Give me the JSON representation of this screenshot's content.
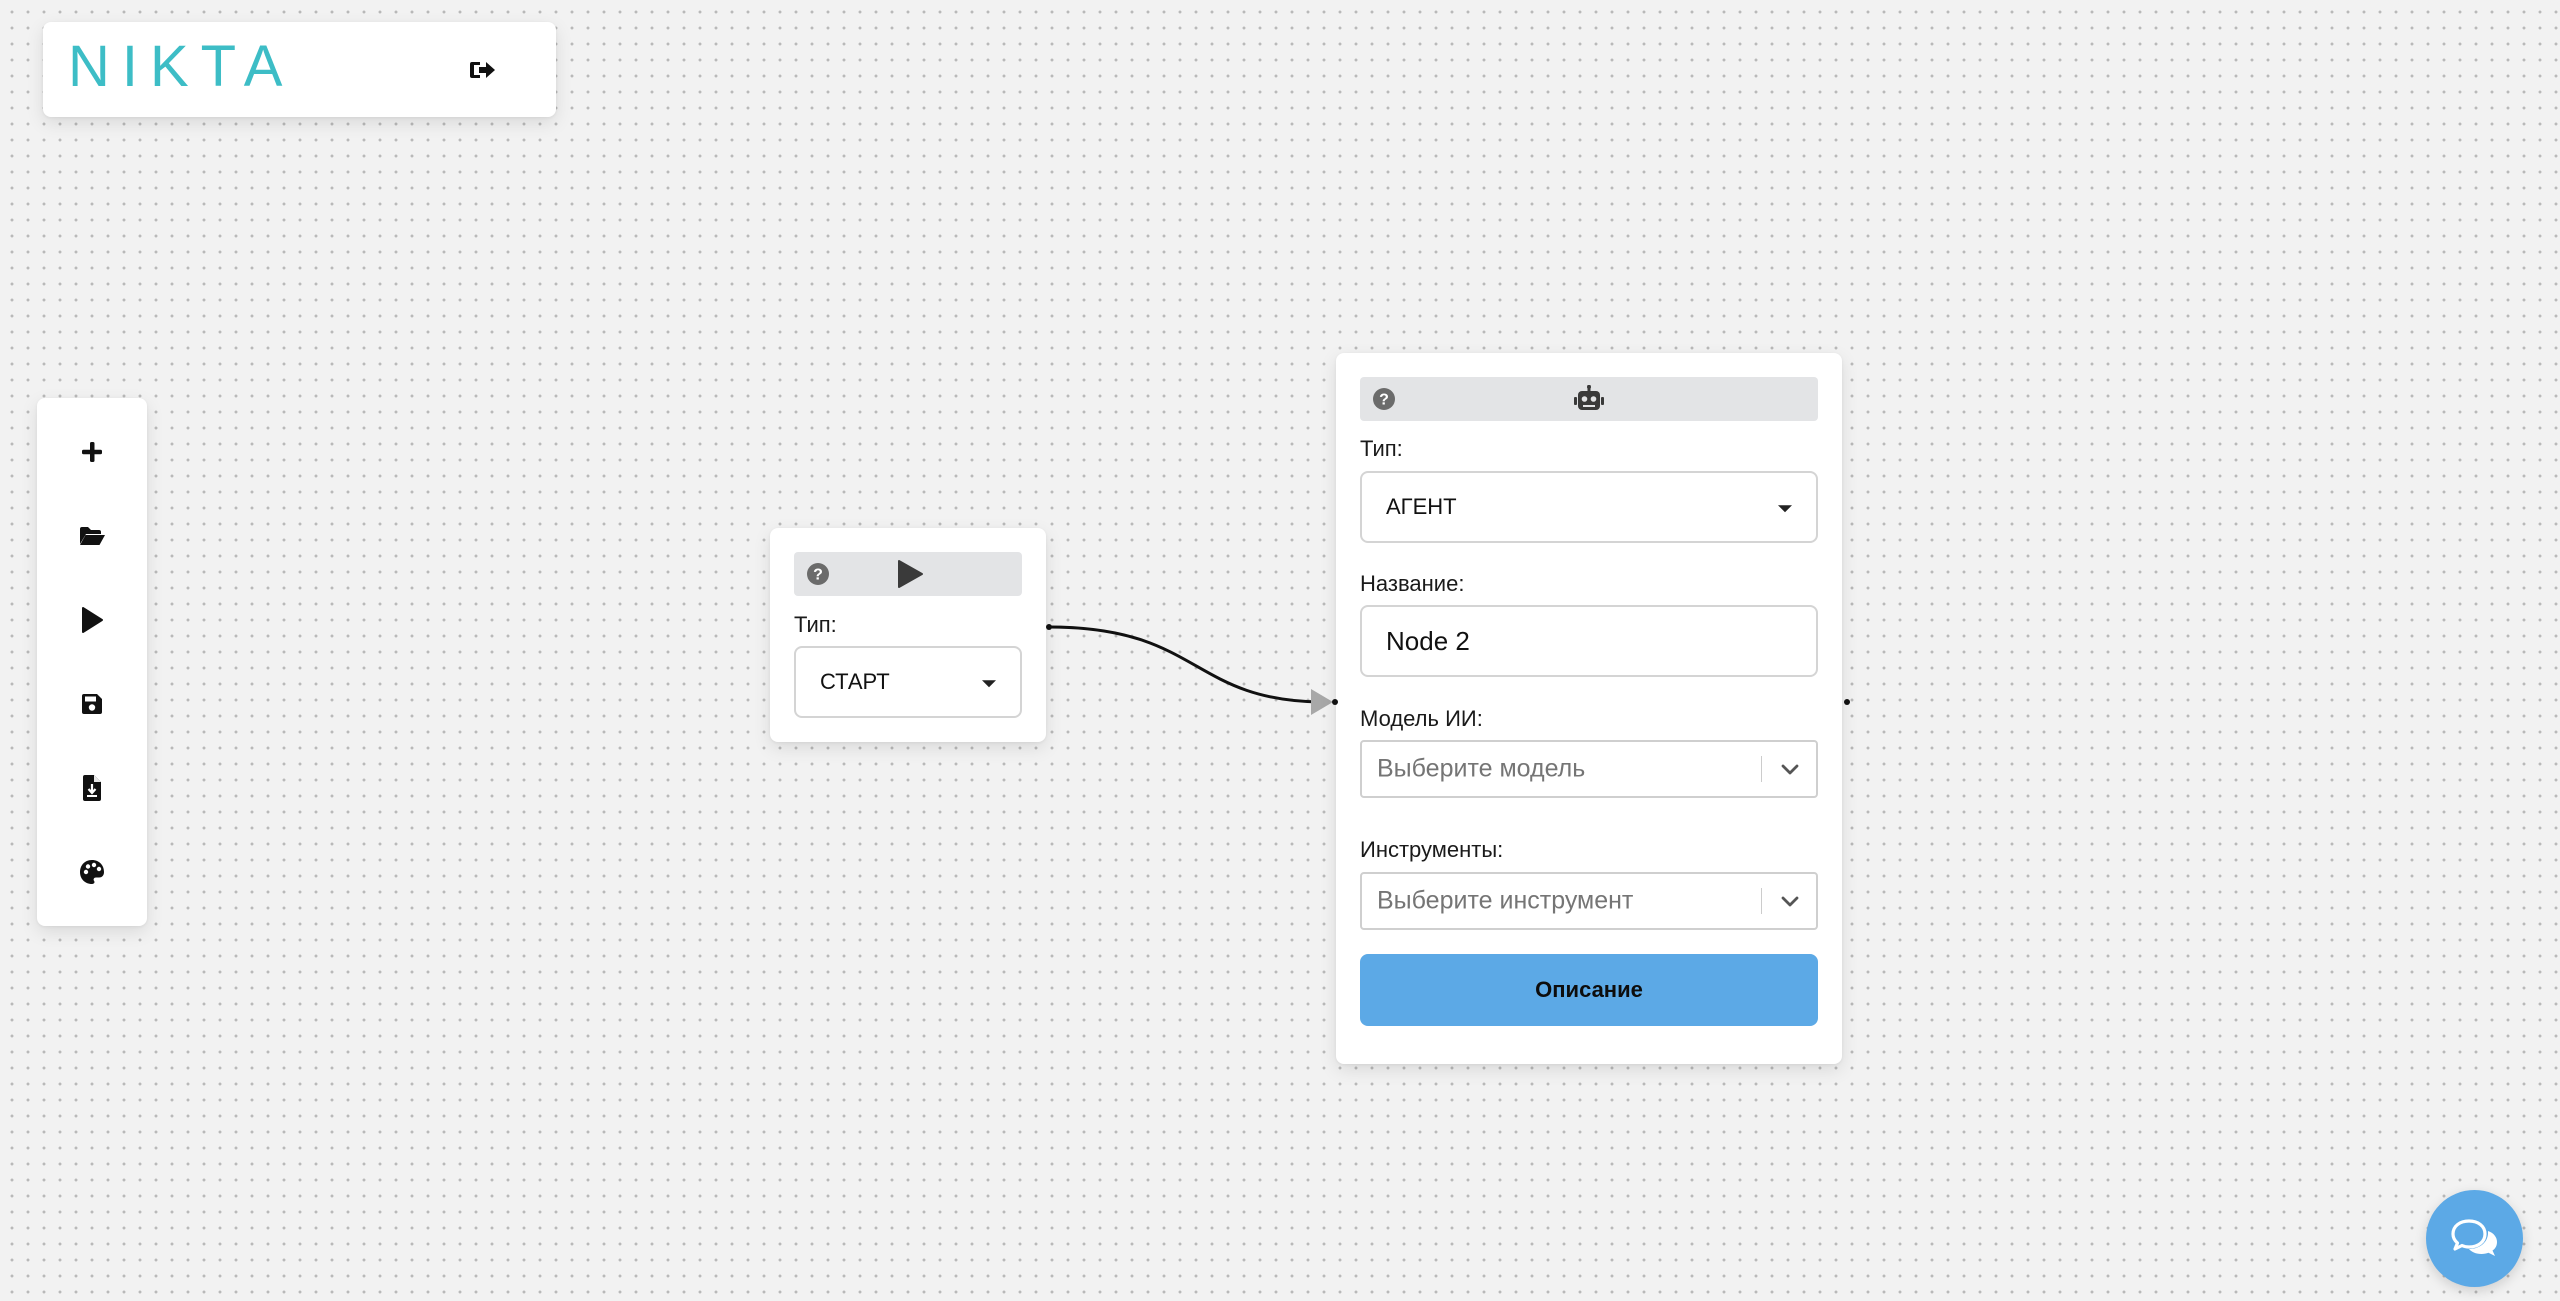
{
  "app": {
    "logo_text": "NIKTA"
  },
  "icons": {
    "logout": "sign-out-icon",
    "add": "plus-icon",
    "open": "folder-open-icon",
    "run": "play-icon",
    "save": "save-icon",
    "import": "file-import-icon",
    "theme": "palette-icon",
    "help": "question-circle-icon",
    "robot": "robot-icon",
    "chat": "comments-icon"
  },
  "colors": {
    "brand": "#3dbdc6",
    "accent": "#5ca9e6",
    "canvas": "#f2f2f2"
  },
  "start_node": {
    "type_label": "Тип:",
    "type_value": "СТАРТ"
  },
  "agent_node": {
    "type_label": "Тип:",
    "type_value": "АГЕНТ",
    "name_label": "Название:",
    "name_value": "Node 2",
    "model_label": "Модель ИИ:",
    "model_placeholder": "Выберите модель",
    "tools_label": "Инструменты:",
    "tools_placeholder": "Выберите инструмент",
    "description_button": "Описание"
  }
}
